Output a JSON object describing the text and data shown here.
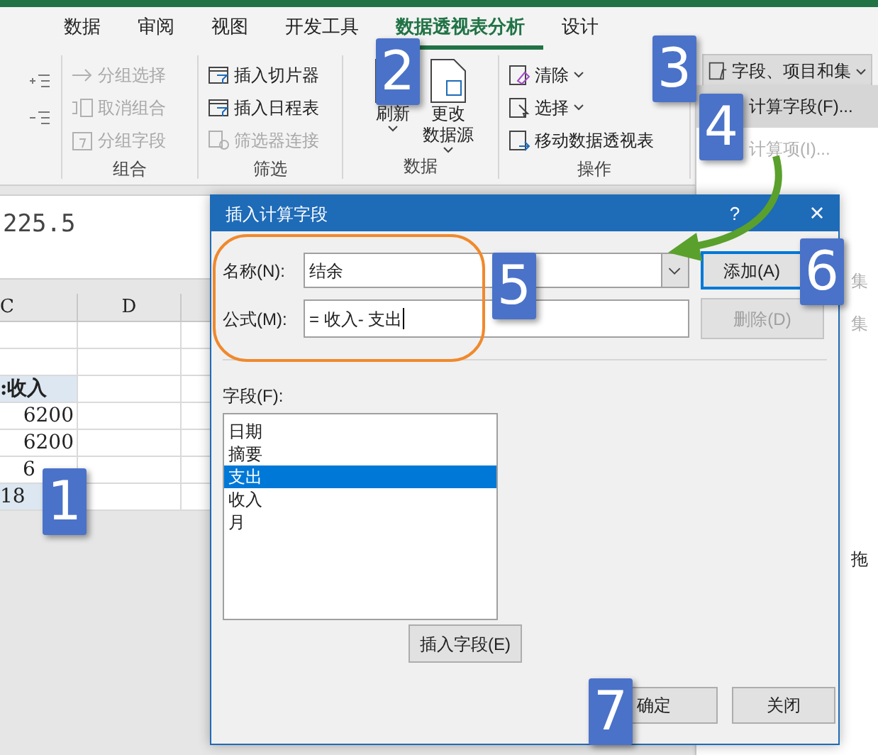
{
  "ribbon_tabs": [
    {
      "label": "数据",
      "selected": false
    },
    {
      "label": "审阅",
      "selected": false
    },
    {
      "label": "视图",
      "selected": false
    },
    {
      "label": "开发工具",
      "selected": false
    },
    {
      "label": "数据透视表分析",
      "selected": true
    },
    {
      "label": "设计",
      "selected": false
    }
  ],
  "ribbon_groups": [
    {
      "name": "组合",
      "kind": "small",
      "items": [
        {
          "label": "分组选择",
          "disabled": true,
          "dropdown": false
        },
        {
          "label": "取消组合",
          "disabled": true,
          "dropdown": false
        },
        {
          "label": "分组字段",
          "disabled": true,
          "dropdown": false
        }
      ]
    },
    {
      "name": "筛选",
      "kind": "small",
      "items": [
        {
          "label": "插入切片器",
          "disabled": false,
          "dropdown": false
        },
        {
          "label": "插入日程表",
          "disabled": false,
          "dropdown": false
        },
        {
          "label": "筛选器连接",
          "disabled": true,
          "dropdown": false
        }
      ]
    },
    {
      "name": "数据",
      "kind": "large",
      "items": [
        {
          "lines": [
            "刷新"
          ],
          "dropdown": true
        },
        {
          "lines": [
            "更改",
            "数据源"
          ],
          "dropdown": true
        }
      ]
    },
    {
      "name": "操作",
      "kind": "small",
      "items": [
        {
          "label": "清除",
          "disabled": false,
          "dropdown": true
        },
        {
          "label": "选择",
          "disabled": false,
          "dropdown": true
        },
        {
          "label": "移动数据透视表",
          "disabled": false,
          "dropdown": false
        }
      ]
    }
  ],
  "fields_button": {
    "label": "字段、项目和集"
  },
  "menu": [
    {
      "label": "计算字段(F)...",
      "highlighted": true,
      "disabled": false
    },
    {
      "label": "计算项(I)...",
      "highlighted": false,
      "disabled": true
    }
  ],
  "formula_bar": {
    "value": "225.5"
  },
  "grid": {
    "columns": [
      "C",
      "D"
    ],
    "rows": [
      {
        "cells": [
          "",
          ""
        ],
        "kind": "plain"
      },
      {
        "cells": [
          "",
          ""
        ],
        "kind": "plain"
      },
      {
        "cells": [
          ":收入",
          ""
        ],
        "kind": "header"
      },
      {
        "cells": [
          "6200",
          ""
        ],
        "kind": "plain"
      },
      {
        "cells": [
          "6200",
          ""
        ],
        "kind": "plain"
      },
      {
        "cells": [
          "6",
          ""
        ],
        "kind": "covered"
      },
      {
        "cells": [
          "18",
          ""
        ],
        "kind": "total"
      }
    ]
  },
  "right_pane": [
    {
      "text": "集",
      "disabled": true
    },
    {
      "text": "集",
      "disabled": true
    },
    {
      "text": "拖",
      "disabled": false
    }
  ],
  "dialog": {
    "title": "插入计算字段",
    "help": "?",
    "close": "×",
    "name_label": "名称(N):",
    "name_value": "结余",
    "formula_label": "公式(M):",
    "formula_value": "= 收入- 支出",
    "add_button": {
      "label": "添加(A)",
      "default": true,
      "disabled": false
    },
    "delete_button": {
      "label": "删除(D)",
      "default": false,
      "disabled": true
    },
    "fields_label": "字段(F):",
    "fields": [
      {
        "label": "日期",
        "selected": false
      },
      {
        "label": "摘要",
        "selected": false
      },
      {
        "label": "支出",
        "selected": true
      },
      {
        "label": "收入",
        "selected": false
      },
      {
        "label": "月",
        "selected": false
      }
    ],
    "insert_field_button": "插入字段(E)",
    "ok_button": "确定",
    "close_button": "关闭"
  },
  "badges": [
    {
      "number": "1"
    },
    {
      "number": "2"
    },
    {
      "number": "3"
    },
    {
      "number": "4"
    },
    {
      "number": "5"
    },
    {
      "number": "6"
    },
    {
      "number": "7"
    }
  ]
}
